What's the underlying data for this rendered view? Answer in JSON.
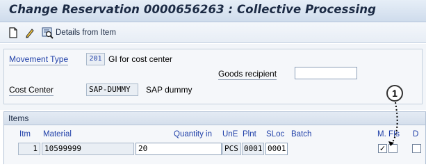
{
  "title": "Change Reservation 0000656263 : Collective Processing",
  "toolbar": {
    "create_icon": "new-document-icon",
    "change_icon": "pencil-icon",
    "details_icon": "magnifier-detail-icon",
    "details_label": "Details from Item"
  },
  "header": {
    "movement_type_label": "Movement Type",
    "movement_type_value": "201",
    "movement_type_text": "GI for cost center",
    "goods_recipient_label": "Goods recipient",
    "goods_recipient_value": "",
    "cost_center_label": "Cost Center",
    "cost_center_value": "SAP-DUMMY",
    "cost_center_text": "SAP dummy"
  },
  "items": {
    "section_label": "Items",
    "columns": {
      "itm": "Itm",
      "material": "Material",
      "quantity": "Quantity in",
      "une": "UnE",
      "plnt": "Plnt",
      "sloc": "SLoc",
      "batch": "Batch",
      "m": "M.",
      "fis": "FIs",
      "d": "D"
    },
    "rows": [
      {
        "itm": "1",
        "material": "10599999",
        "quantity": "20",
        "une": "PCS",
        "plnt": "0001",
        "sloc": "0001",
        "batch": "",
        "m_checked": "✓",
        "fis_checked": "",
        "d_checked": ""
      }
    ]
  },
  "callout": {
    "number": "1"
  }
}
